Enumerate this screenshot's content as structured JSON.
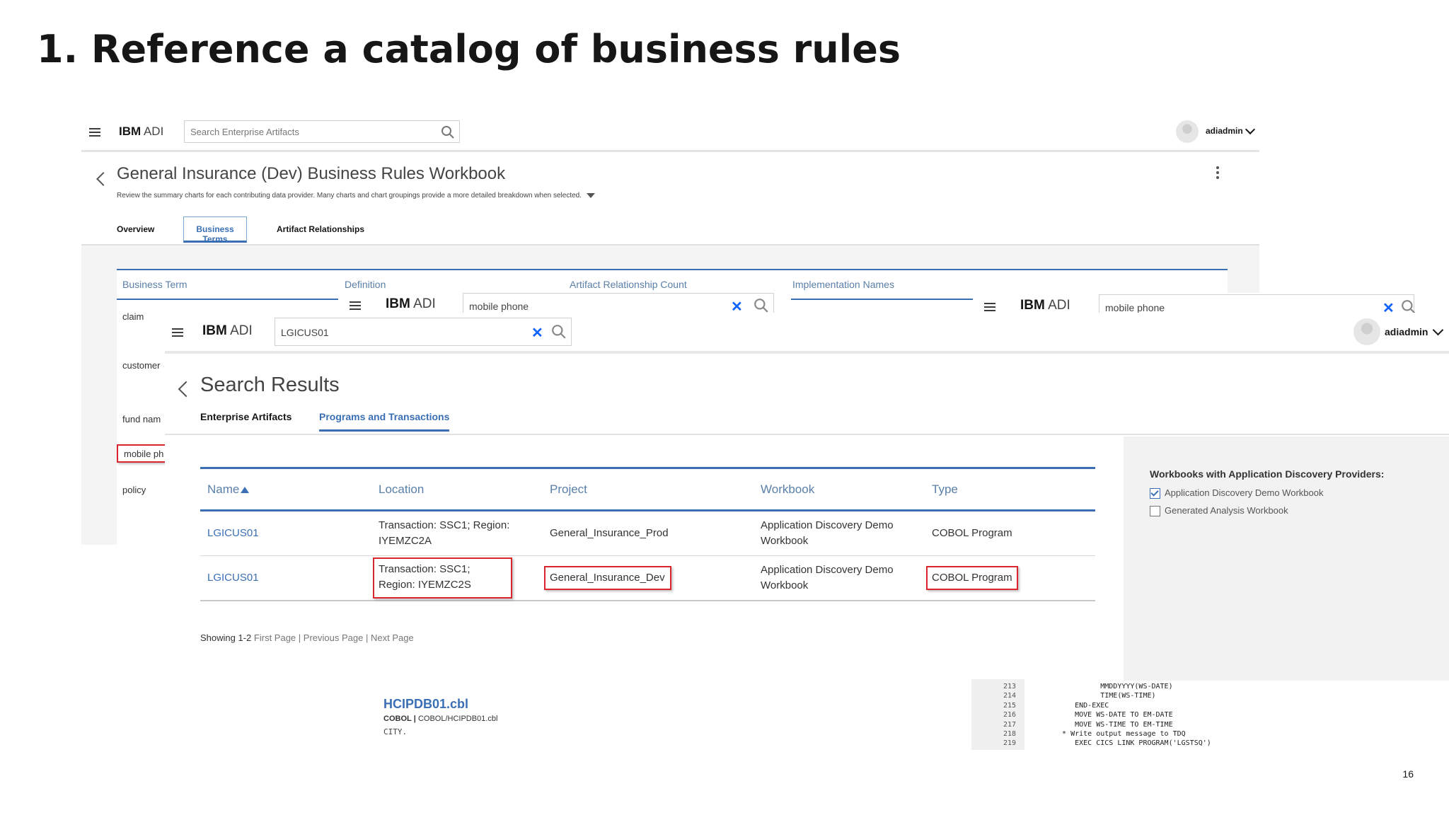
{
  "slide": {
    "title": "1. Reference a catalog of business rules",
    "page_number": "16"
  },
  "back_window": {
    "brand_bold": "IBM",
    "brand_light": "ADI",
    "search_placeholder": "Search Enterprise Artifacts",
    "user": "adiadmin",
    "workbook_title": "General Insurance (Dev) Business Rules Workbook",
    "description": "Review the summary charts for each contributing data provider. Many charts and chart groupings provide a more detailed breakdown when selected.",
    "tabs": [
      "Overview",
      "Business Terms",
      "Artifact Relationships"
    ],
    "active_tab": "Business Terms",
    "columns": [
      "Business Term",
      "Definition",
      "Artifact Relationship Count",
      "Implementation Names"
    ],
    "terms": [
      "claim",
      "customer",
      "fund nam",
      "mobile ph",
      "policy"
    ]
  },
  "mid_window_1": {
    "brand_bold": "IBM",
    "brand_light": "ADI",
    "search_value": "mobile phone"
  },
  "mid_window_2": {
    "brand_bold": "IBM",
    "brand_light": "ADI",
    "search_value": "mobile phone"
  },
  "front_window": {
    "brand_bold": "IBM",
    "brand_light": "ADI",
    "search_value": "LGICUS01",
    "user": "adiadmin",
    "page_title": "Search Results",
    "tabs": [
      "Enterprise Artifacts",
      "Programs and Transactions"
    ],
    "active_tab": "Programs and Transactions",
    "columns": [
      "Name",
      "Location",
      "Project",
      "Workbook",
      "Type"
    ],
    "rows": [
      {
        "name": "LGICUS01",
        "location": "Transaction: SSC1; Region: IYEMZC2A",
        "project": "General_Insurance_Prod",
        "workbook": "Application Discovery Demo Workbook",
        "type": "COBOL Program"
      },
      {
        "name": "LGICUS01",
        "location": "Transaction: SSC1; Region: IYEMZC2S",
        "project": "General_Insurance_Dev",
        "workbook": "Application Discovery Demo Workbook",
        "type": "COBOL Program"
      }
    ],
    "pagination": {
      "showing": "Showing 1-2",
      "first": "First Page",
      "previous": "Previous Page",
      "next": "Next Page",
      "sep": "|"
    },
    "filter_panel": {
      "title": "Workbooks with Application Discovery Providers:",
      "options": [
        {
          "label": "Application Discovery Demo Workbook",
          "checked": true
        },
        {
          "label": "Generated Analysis Workbook",
          "checked": false
        }
      ]
    }
  },
  "file_snippet": {
    "file_name": "HCIPDB01.cbl",
    "lang": "COBOL",
    "path": "COBOL/HCIPDB01.cbl",
    "text": "CITY."
  },
  "code_snippet": {
    "line_numbers": [
      "213",
      "214",
      "215",
      "216",
      "217",
      "218",
      "219"
    ],
    "lines": [
      "            MMDDYYYY(WS-DATE)",
      "            TIME(WS-TIME)",
      "      END-EXEC",
      "      MOVE WS-DATE TO EM-DATE",
      "      MOVE WS-TIME TO EM-TIME",
      "   * Write output message to TDQ",
      "      EXEC CICS LINK PROGRAM('LGSTSQ')"
    ]
  }
}
